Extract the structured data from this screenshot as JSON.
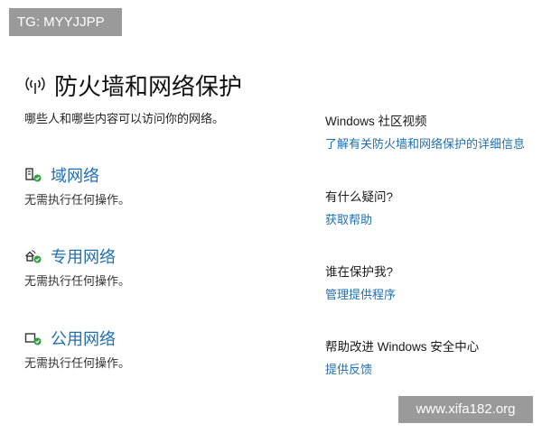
{
  "watermark_top": "TG: MYYJJPP",
  "watermark_bottom": "www.xifa182.org",
  "page": {
    "title": "防火墙和网络保护",
    "subtitle": "哪些人和哪些内容可以访问你的网络。"
  },
  "networks": [
    {
      "icon": "domain-network-icon",
      "label": "域网络",
      "status": "无需执行任何操作。"
    },
    {
      "icon": "private-network-icon",
      "label": "专用网络",
      "status": "无需执行任何操作。"
    },
    {
      "icon": "public-network-icon",
      "label": "公用网络",
      "status": "无需执行任何操作。"
    }
  ],
  "sidebar": [
    {
      "heading": "Windows 社区视频",
      "link": "了解有关防火墙和网络保护的详细信息"
    },
    {
      "heading": "有什么疑问?",
      "link": "获取帮助"
    },
    {
      "heading": "谁在保护我?",
      "link": "管理提供程序"
    },
    {
      "heading": "帮助改进 Windows 安全中心",
      "link": "提供反馈"
    }
  ],
  "colors": {
    "link": "#1f6fb2",
    "ok": "#2e9e3e",
    "badge": "#9a9a9a"
  }
}
